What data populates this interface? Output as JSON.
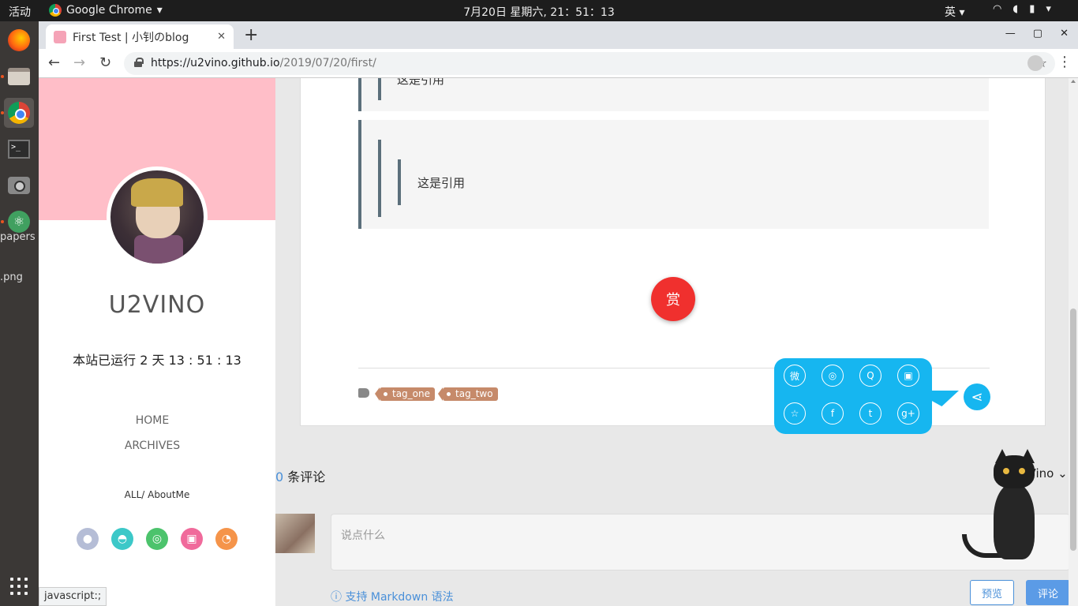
{
  "topbar": {
    "activities": "活动",
    "app_name": "Google Chrome",
    "clock": "7月20日 星期六, 21：51：13",
    "ime": "英"
  },
  "dock": {
    "bleed_text_1": "papers",
    "bleed_text_2": ".png"
  },
  "browser": {
    "tab_title": "First Test | 小钊のblog",
    "url_host": "https://u2vino.github.io",
    "url_path": "/2019/07/20/first/",
    "status_text": "javascript:;"
  },
  "sidebar": {
    "site_name": "U2VINO",
    "runtime": "本站已运行 2 天 13 : 51 : 13",
    "menu": [
      "HOME",
      "ARCHIVES"
    ],
    "categories": "ALL/ AboutMe",
    "socials": [
      "github-icon",
      "qq-icon",
      "wechat-icon",
      "bilibili-icon",
      "rss-icon"
    ],
    "colors": {
      "banner": "#ffbec8",
      "github": "#b5bdd6",
      "qq": "#3cc8c8",
      "wechat": "#4cc36c",
      "bilibili": "#f06a9b",
      "rss": "#f5944a"
    }
  },
  "article": {
    "quote_1": "这是引用",
    "quote_2": "这是引用",
    "reward_label": "赏",
    "tags": [
      "tag_one",
      "tag_two"
    ]
  },
  "share": {
    "icons": [
      "weibo-icon",
      "wechat-icon",
      "qq-icon",
      "qzone-icon",
      "star-icon",
      "facebook-icon",
      "twitter-icon",
      "googleplus-icon"
    ],
    "glyphs": [
      "微",
      "◎",
      "Q",
      "▣",
      "☆",
      "f",
      "t",
      "g+"
    ],
    "color": "#16b6f0"
  },
  "comments": {
    "count": "0",
    "count_suffix": " 条评论",
    "user": "2Vino ⌄",
    "placeholder": "说点什么",
    "markdown_tip": "ⓘ 支持 Markdown 语法",
    "preview_label": "预览",
    "submit_label": "评论"
  }
}
